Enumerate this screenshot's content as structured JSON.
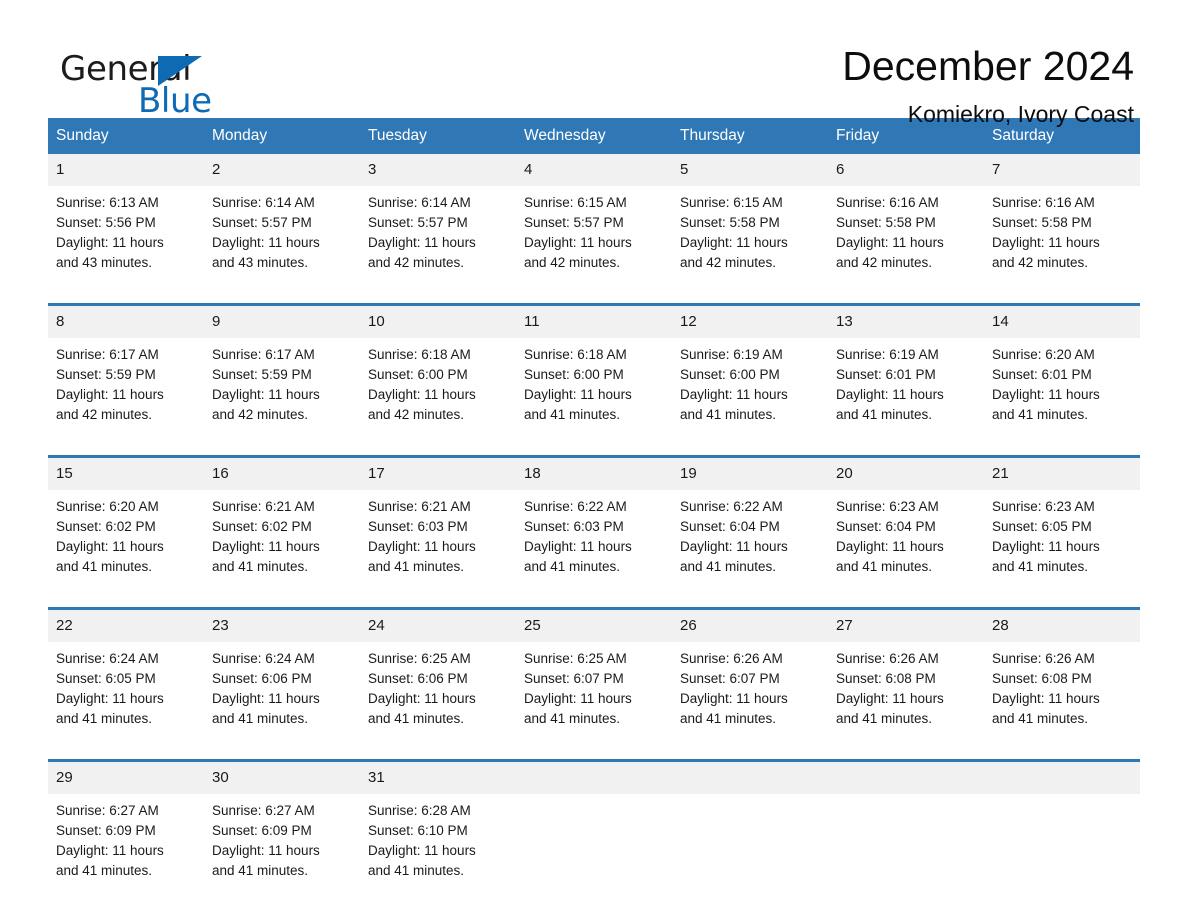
{
  "logo": {
    "text_top": "General",
    "text_bottom": "Blue",
    "triangle_color": "#0f6ab4"
  },
  "header": {
    "month_title": "December 2024",
    "location": "Komiekro, Ivory Coast"
  },
  "theme": {
    "header_blue": "#3077b5",
    "daynum_band": "#f1f1f1",
    "text": "#1a1a1a"
  },
  "weekdays": [
    "Sunday",
    "Monday",
    "Tuesday",
    "Wednesday",
    "Thursday",
    "Friday",
    "Saturday"
  ],
  "weeks": [
    {
      "days": [
        {
          "date": "1",
          "sunrise": "Sunrise: 6:13 AM",
          "sunset": "Sunset: 5:56 PM",
          "daylight_line1": "Daylight: 11 hours",
          "daylight_line2": "and 43 minutes."
        },
        {
          "date": "2",
          "sunrise": "Sunrise: 6:14 AM",
          "sunset": "Sunset: 5:57 PM",
          "daylight_line1": "Daylight: 11 hours",
          "daylight_line2": "and 43 minutes."
        },
        {
          "date": "3",
          "sunrise": "Sunrise: 6:14 AM",
          "sunset": "Sunset: 5:57 PM",
          "daylight_line1": "Daylight: 11 hours",
          "daylight_line2": "and 42 minutes."
        },
        {
          "date": "4",
          "sunrise": "Sunrise: 6:15 AM",
          "sunset": "Sunset: 5:57 PM",
          "daylight_line1": "Daylight: 11 hours",
          "daylight_line2": "and 42 minutes."
        },
        {
          "date": "5",
          "sunrise": "Sunrise: 6:15 AM",
          "sunset": "Sunset: 5:58 PM",
          "daylight_line1": "Daylight: 11 hours",
          "daylight_line2": "and 42 minutes."
        },
        {
          "date": "6",
          "sunrise": "Sunrise: 6:16 AM",
          "sunset": "Sunset: 5:58 PM",
          "daylight_line1": "Daylight: 11 hours",
          "daylight_line2": "and 42 minutes."
        },
        {
          "date": "7",
          "sunrise": "Sunrise: 6:16 AM",
          "sunset": "Sunset: 5:58 PM",
          "daylight_line1": "Daylight: 11 hours",
          "daylight_line2": "and 42 minutes."
        }
      ]
    },
    {
      "days": [
        {
          "date": "8",
          "sunrise": "Sunrise: 6:17 AM",
          "sunset": "Sunset: 5:59 PM",
          "daylight_line1": "Daylight: 11 hours",
          "daylight_line2": "and 42 minutes."
        },
        {
          "date": "9",
          "sunrise": "Sunrise: 6:17 AM",
          "sunset": "Sunset: 5:59 PM",
          "daylight_line1": "Daylight: 11 hours",
          "daylight_line2": "and 42 minutes."
        },
        {
          "date": "10",
          "sunrise": "Sunrise: 6:18 AM",
          "sunset": "Sunset: 6:00 PM",
          "daylight_line1": "Daylight: 11 hours",
          "daylight_line2": "and 42 minutes."
        },
        {
          "date": "11",
          "sunrise": "Sunrise: 6:18 AM",
          "sunset": "Sunset: 6:00 PM",
          "daylight_line1": "Daylight: 11 hours",
          "daylight_line2": "and 41 minutes."
        },
        {
          "date": "12",
          "sunrise": "Sunrise: 6:19 AM",
          "sunset": "Sunset: 6:00 PM",
          "daylight_line1": "Daylight: 11 hours",
          "daylight_line2": "and 41 minutes."
        },
        {
          "date": "13",
          "sunrise": "Sunrise: 6:19 AM",
          "sunset": "Sunset: 6:01 PM",
          "daylight_line1": "Daylight: 11 hours",
          "daylight_line2": "and 41 minutes."
        },
        {
          "date": "14",
          "sunrise": "Sunrise: 6:20 AM",
          "sunset": "Sunset: 6:01 PM",
          "daylight_line1": "Daylight: 11 hours",
          "daylight_line2": "and 41 minutes."
        }
      ]
    },
    {
      "days": [
        {
          "date": "15",
          "sunrise": "Sunrise: 6:20 AM",
          "sunset": "Sunset: 6:02 PM",
          "daylight_line1": "Daylight: 11 hours",
          "daylight_line2": "and 41 minutes."
        },
        {
          "date": "16",
          "sunrise": "Sunrise: 6:21 AM",
          "sunset": "Sunset: 6:02 PM",
          "daylight_line1": "Daylight: 11 hours",
          "daylight_line2": "and 41 minutes."
        },
        {
          "date": "17",
          "sunrise": "Sunrise: 6:21 AM",
          "sunset": "Sunset: 6:03 PM",
          "daylight_line1": "Daylight: 11 hours",
          "daylight_line2": "and 41 minutes."
        },
        {
          "date": "18",
          "sunrise": "Sunrise: 6:22 AM",
          "sunset": "Sunset: 6:03 PM",
          "daylight_line1": "Daylight: 11 hours",
          "daylight_line2": "and 41 minutes."
        },
        {
          "date": "19",
          "sunrise": "Sunrise: 6:22 AM",
          "sunset": "Sunset: 6:04 PM",
          "daylight_line1": "Daylight: 11 hours",
          "daylight_line2": "and 41 minutes."
        },
        {
          "date": "20",
          "sunrise": "Sunrise: 6:23 AM",
          "sunset": "Sunset: 6:04 PM",
          "daylight_line1": "Daylight: 11 hours",
          "daylight_line2": "and 41 minutes."
        },
        {
          "date": "21",
          "sunrise": "Sunrise: 6:23 AM",
          "sunset": "Sunset: 6:05 PM",
          "daylight_line1": "Daylight: 11 hours",
          "daylight_line2": "and 41 minutes."
        }
      ]
    },
    {
      "days": [
        {
          "date": "22",
          "sunrise": "Sunrise: 6:24 AM",
          "sunset": "Sunset: 6:05 PM",
          "daylight_line1": "Daylight: 11 hours",
          "daylight_line2": "and 41 minutes."
        },
        {
          "date": "23",
          "sunrise": "Sunrise: 6:24 AM",
          "sunset": "Sunset: 6:06 PM",
          "daylight_line1": "Daylight: 11 hours",
          "daylight_line2": "and 41 minutes."
        },
        {
          "date": "24",
          "sunrise": "Sunrise: 6:25 AM",
          "sunset": "Sunset: 6:06 PM",
          "daylight_line1": "Daylight: 11 hours",
          "daylight_line2": "and 41 minutes."
        },
        {
          "date": "25",
          "sunrise": "Sunrise: 6:25 AM",
          "sunset": "Sunset: 6:07 PM",
          "daylight_line1": "Daylight: 11 hours",
          "daylight_line2": "and 41 minutes."
        },
        {
          "date": "26",
          "sunrise": "Sunrise: 6:26 AM",
          "sunset": "Sunset: 6:07 PM",
          "daylight_line1": "Daylight: 11 hours",
          "daylight_line2": "and 41 minutes."
        },
        {
          "date": "27",
          "sunrise": "Sunrise: 6:26 AM",
          "sunset": "Sunset: 6:08 PM",
          "daylight_line1": "Daylight: 11 hours",
          "daylight_line2": "and 41 minutes."
        },
        {
          "date": "28",
          "sunrise": "Sunrise: 6:26 AM",
          "sunset": "Sunset: 6:08 PM",
          "daylight_line1": "Daylight: 11 hours",
          "daylight_line2": "and 41 minutes."
        }
      ]
    },
    {
      "days": [
        {
          "date": "29",
          "sunrise": "Sunrise: 6:27 AM",
          "sunset": "Sunset: 6:09 PM",
          "daylight_line1": "Daylight: 11 hours",
          "daylight_line2": "and 41 minutes."
        },
        {
          "date": "30",
          "sunrise": "Sunrise: 6:27 AM",
          "sunset": "Sunset: 6:09 PM",
          "daylight_line1": "Daylight: 11 hours",
          "daylight_line2": "and 41 minutes."
        },
        {
          "date": "31",
          "sunrise": "Sunrise: 6:28 AM",
          "sunset": "Sunset: 6:10 PM",
          "daylight_line1": "Daylight: 11 hours",
          "daylight_line2": "and 41 minutes."
        },
        {
          "date": "",
          "sunrise": "",
          "sunset": "",
          "daylight_line1": "",
          "daylight_line2": "",
          "empty": true
        },
        {
          "date": "",
          "sunrise": "",
          "sunset": "",
          "daylight_line1": "",
          "daylight_line2": "",
          "empty": true
        },
        {
          "date": "",
          "sunrise": "",
          "sunset": "",
          "daylight_line1": "",
          "daylight_line2": "",
          "empty": true
        },
        {
          "date": "",
          "sunrise": "",
          "sunset": "",
          "daylight_line1": "",
          "daylight_line2": "",
          "empty": true
        }
      ]
    }
  ]
}
